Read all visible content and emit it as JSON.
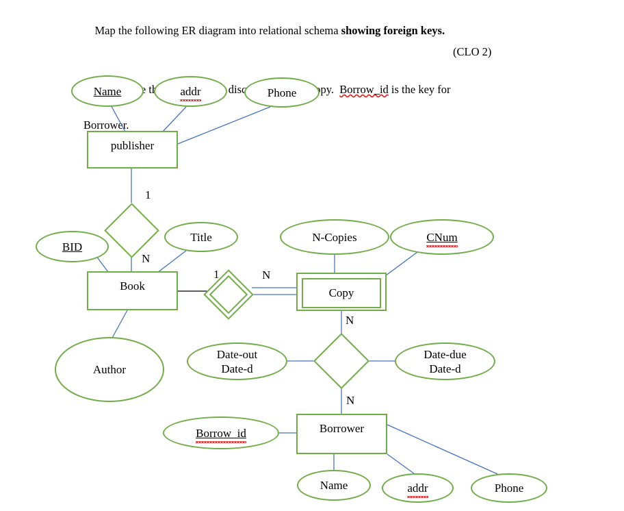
{
  "prompt": {
    "line1_a": "Map the following ER diagram into relational schema ",
    "line1_b": "showing foreign keys.",
    "line2_a": "Please note that ",
    "line2_b": "CNum",
    "line2_c": " is the discriminator for Copy.  ",
    "line2_d": "Borrow_id",
    "line2_e": " is the key for",
    "line3": "Borrower.",
    "clo": "(CLO 2)"
  },
  "colors": {
    "shape_stroke": "#70ad47",
    "connector": "#4472c4",
    "connector_black": "#000000",
    "text": "#000000",
    "spellcheck": "#e01b1b",
    "background": "#ffffff"
  },
  "diagram": {
    "entities": [
      {
        "id": "publisher",
        "label": "publisher",
        "weak": false
      },
      {
        "id": "book",
        "label": "Book",
        "weak": false
      },
      {
        "id": "copy",
        "label": "Copy",
        "weak": true
      },
      {
        "id": "borrower",
        "label": "Borrower",
        "weak": false
      }
    ],
    "attributes": [
      {
        "id": "pub-name",
        "label": "Name",
        "key": true,
        "spell": false,
        "owner": "publisher"
      },
      {
        "id": "pub-addr",
        "label": "addr",
        "key": false,
        "spell": true,
        "owner": "publisher"
      },
      {
        "id": "pub-phone",
        "label": "Phone",
        "key": false,
        "spell": false,
        "owner": "publisher"
      },
      {
        "id": "book-bid",
        "label": "BID",
        "key": true,
        "spell": false,
        "owner": "book"
      },
      {
        "id": "book-title",
        "label": "Title",
        "key": false,
        "spell": false,
        "owner": "book"
      },
      {
        "id": "book-author",
        "label": "Author",
        "key": false,
        "spell": false,
        "owner": "book"
      },
      {
        "id": "copy-ncopies",
        "label": "N-Copies",
        "key": false,
        "spell": false,
        "owner": "copy"
      },
      {
        "id": "copy-cnum",
        "label": "CNum",
        "key": true,
        "spell": true,
        "owner": "copy"
      },
      {
        "id": "rel-dateout",
        "label_line1": "Date-out",
        "label_line2": "Date-d",
        "key": false,
        "spell": false,
        "owner": "borrow-rel"
      },
      {
        "id": "rel-datedue",
        "label_line1": "Date-due",
        "label_line2": "Date-d",
        "key": false,
        "spell": false,
        "owner": "borrow-rel"
      },
      {
        "id": "bor-borrowid",
        "label": "Borrow_id",
        "key": true,
        "spell": true,
        "owner": "borrower"
      },
      {
        "id": "bor-name",
        "label": "Name",
        "key": false,
        "spell": false,
        "owner": "borrower"
      },
      {
        "id": "bor-addr",
        "label": "addr",
        "key": false,
        "spell": true,
        "owner": "borrower"
      },
      {
        "id": "bor-phone",
        "label": "Phone",
        "key": false,
        "spell": false,
        "owner": "borrower"
      }
    ],
    "relationships": [
      {
        "id": "pub-book-rel",
        "label": "",
        "identifying": false,
        "from": "publisher",
        "to": "book",
        "from_card": "1",
        "to_card": "N"
      },
      {
        "id": "book-copy-rel",
        "label": "",
        "identifying": true,
        "from": "book",
        "to": "copy",
        "from_card": "1",
        "to_card": "N"
      },
      {
        "id": "borrow-rel",
        "label": "",
        "identifying": false,
        "from": "copy",
        "to": "borrower",
        "from_card": "N",
        "to_card": "N"
      }
    ],
    "cardinality_labels": [
      {
        "id": "card-pub-1",
        "text": "1"
      },
      {
        "id": "card-book-n",
        "text": "N"
      },
      {
        "id": "card-book-1",
        "text": "1"
      },
      {
        "id": "card-copy-n",
        "text": "N"
      },
      {
        "id": "card-copyrel-n",
        "text": "N"
      },
      {
        "id": "card-borrower-n",
        "text": "N"
      }
    ]
  }
}
